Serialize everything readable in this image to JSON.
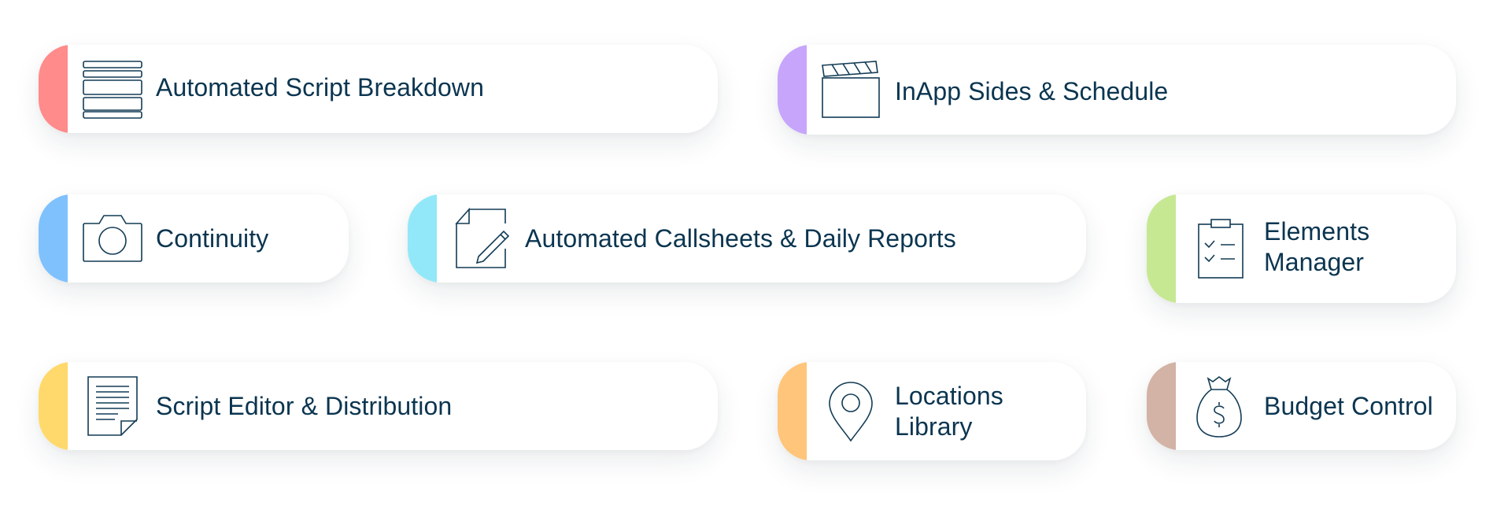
{
  "features": [
    {
      "id": "script-breakdown",
      "label": "Automated Script Breakdown",
      "icon": "script-breakdown-icon",
      "accent": "#ff8b8b"
    },
    {
      "id": "sides-schedule",
      "label": "InApp Sides & Schedule",
      "icon": "clapperboard-icon",
      "accent": "#c6a5fb"
    },
    {
      "id": "continuity",
      "label": "Continuity",
      "icon": "camera-icon",
      "accent": "#7fc1fd"
    },
    {
      "id": "callsheets",
      "label": "Automated Callsheets & Daily Reports",
      "icon": "document-pencil-icon",
      "accent": "#92e8f8"
    },
    {
      "id": "elements-manager",
      "label_line1": "Elements",
      "label_line2": "Manager",
      "icon": "clipboard-checklist-icon",
      "accent": "#c6e893"
    },
    {
      "id": "script-editor",
      "label": "Script Editor & Distribution",
      "icon": "document-icon",
      "accent": "#ffd96b"
    },
    {
      "id": "locations-library",
      "label_line1": "Locations",
      "label_line2": "Library",
      "icon": "map-pin-icon",
      "accent": "#ffc57a"
    },
    {
      "id": "budget-control",
      "label": "Budget Control",
      "icon": "money-bag-icon",
      "accent": "#d3b3a5"
    }
  ]
}
